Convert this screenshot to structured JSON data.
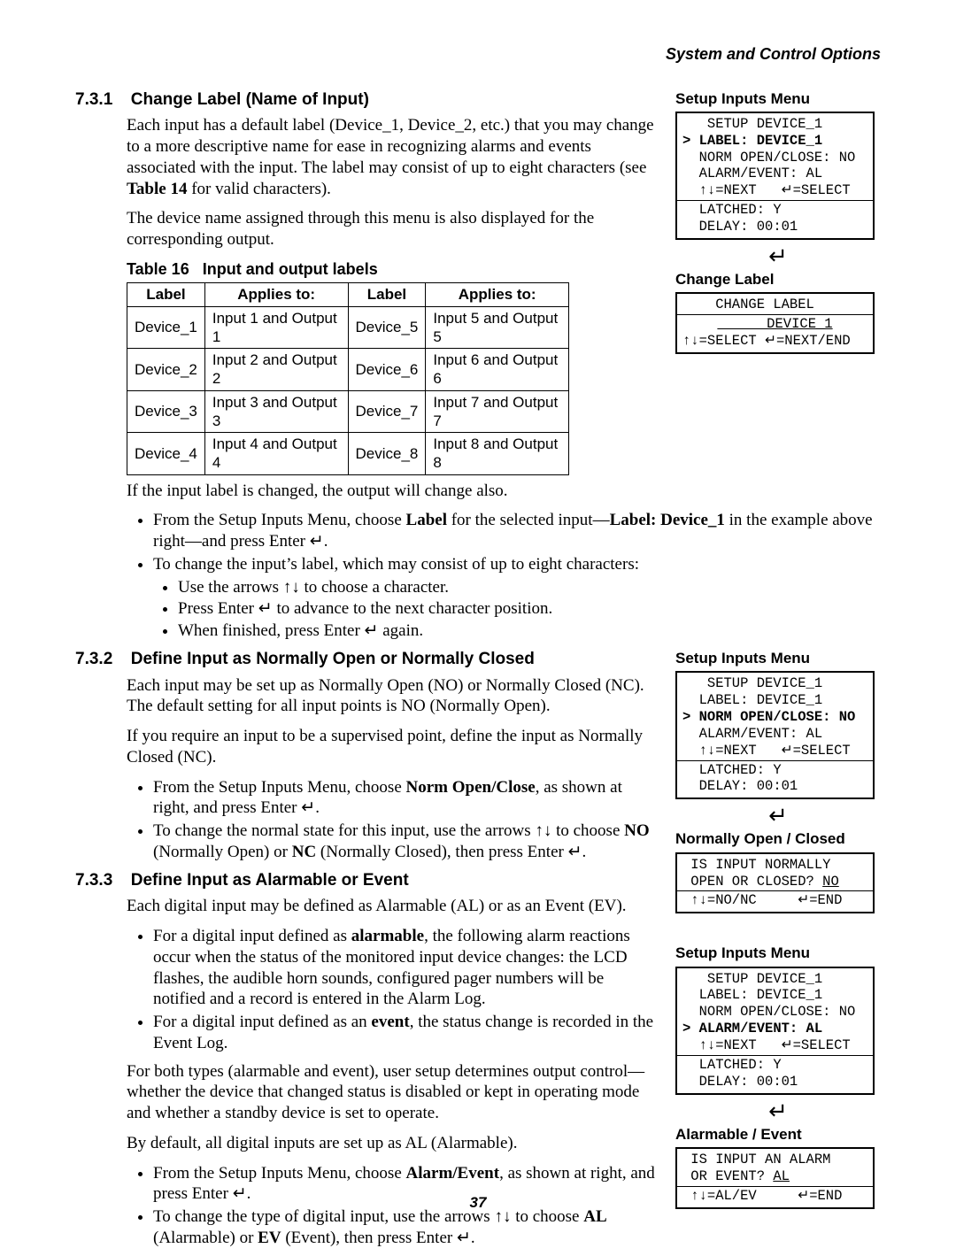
{
  "runhead": "System and Control Options",
  "page_number": "37",
  "glyphs": {
    "updown": "↑↓",
    "enter": "↵",
    "enter_big": "↵"
  },
  "sec_731": {
    "num": "7.3.1",
    "title": "Change Label (Name of Input)",
    "p1a": "Each input has a default label (Device_1, Device_2, etc.) that you may change to a more descriptive name for ease in recognizing alarms and events associated with the input. The label may consist of up to eight characters (see ",
    "p1b": "Table 14",
    "p1c": " for valid characters).",
    "p2": "The device name assigned through this menu is also displayed for the corresponding output.",
    "table_caption_a": "Table 16",
    "table_caption_b": "Input and output labels",
    "table_headers": [
      "Label",
      "Applies to:",
      "Label",
      "Applies to:"
    ],
    "table_rows": [
      [
        "Device_1",
        "Input 1 and Output 1",
        "Device_5",
        "Input 5 and Output 5"
      ],
      [
        "Device_2",
        "Input 2 and Output 2",
        "Device_6",
        "Input 6 and Output 6"
      ],
      [
        "Device_3",
        "Input 3 and Output 3",
        "Device_7",
        "Input 7 and Output 7"
      ],
      [
        "Device_4",
        "Input 4 and Output 4",
        "Device_8",
        "Input 8 and Output 8"
      ]
    ],
    "p3": "If the input label is changed, the output will change also.",
    "b1a": "From the Setup Inputs Menu, choose ",
    "b1b": "Label",
    "b1c": " for the selected input—",
    "b1d": "Label: Device_1",
    "b1e": " in the example above right—and press Enter ",
    "b1f": ".",
    "b2": "To change the input’s label, which may consist of up to eight characters:",
    "b2i1a": "Use the arrows ",
    "b2i1b": " to choose a character.",
    "b2i2a": "Press Enter ",
    "b2i2b": " to advance to the next character position.",
    "b2i3a": "When finished, press Enter ",
    "b2i3b": " again."
  },
  "lcd_731_setup": {
    "title": "Setup Inputs Menu",
    "l1": "   SETUP DEVICE_1",
    "l2": "> LABEL: DEVICE_1",
    "l3": "  NORM OPEN/CLOSE: NO",
    "l4": "  ALARM/EVENT: AL",
    "l5": "  ↑↓=NEXT   ↵=SELECT",
    "l6": "  LATCHED: Y",
    "l7": "  DELAY: 00:01"
  },
  "lcd_731_change": {
    "title": "Change Label",
    "l1": "    CHANGE LABEL",
    "l2": "      DEVICE_1",
    "l3": "↑↓=SELECT ↵=NEXT/END"
  },
  "sec_732": {
    "num": "7.3.2",
    "title": "Define Input as Normally Open or Normally Closed",
    "p1": "Each input may be set up as Normally Open (NO) or Normally Closed (NC). The default setting for all input points is NO (Normally Open).",
    "p2": "If you require an input to be a supervised point, define the input as Normally Closed (NC).",
    "b1a": "From the Setup Inputs Menu, choose ",
    "b1b": "Norm Open/Close",
    "b1c": ", as shown at right, and press Enter ",
    "b1d": ".",
    "b2a": "To change the normal state for this input, use the arrows ",
    "b2b": " to choose ",
    "b2c": "NO",
    "b2d": " (Normally Open) or ",
    "b2e": "NC",
    "b2f": " (Normally Closed), then press Enter ",
    "b2g": "."
  },
  "lcd_732_setup": {
    "title": "Setup Inputs Menu",
    "l1": "   SETUP DEVICE_1",
    "l2": "  LABEL: DEVICE_1",
    "l3": "> NORM OPEN/CLOSE: NO",
    "l4": "  ALARM/EVENT: AL",
    "l5": "  ↑↓=NEXT   ↵=SELECT",
    "l6": "  LATCHED: Y",
    "l7": "  DELAY: 00:01"
  },
  "lcd_732_noc": {
    "title": "Normally Open / Closed",
    "l1": " IS INPUT NORMALLY",
    "l2a": " OPEN OR CLOSED? ",
    "l2b": "NO",
    "l3": " ↑↓=NO/NC     ↵=END"
  },
  "sec_733": {
    "num": "7.3.3",
    "title": "Define Input as Alarmable or Event",
    "p1": "Each digital input may be defined as Alarmable (AL) or as an Event (EV).",
    "b1a": "For a digital input defined as ",
    "b1b": "alarmable",
    "b1c": ", the following alarm reactions occur when the status of the monitored input device changes: the LCD flashes, the audible horn sounds, configured pager numbers will be notified and a record is entered in the Alarm Log.",
    "b2a": "For a digital input defined as an ",
    "b2b": "event",
    "b2c": ", the status change is recorded in the Event Log.",
    "p2": "For both types (alarmable and event), user setup determines output control—whether the device that changed status is disabled or kept in operating mode and whether a standby device is set to operate.",
    "p3": "By default, all digital inputs are set up as AL (Alarmable).",
    "b3a": "From the Setup Inputs Menu, choose ",
    "b3b": "Alarm/Event",
    "b3c": ", as shown at right, and press Enter ",
    "b3d": ".",
    "b4a": "To change the type of digital input, use the arrows ",
    "b4b": " to choose ",
    "b4c": "AL",
    "b4d": " (Alarmable) or ",
    "b4e": "EV",
    "b4f": " (Event), then press Enter ",
    "b4g": "."
  },
  "lcd_733_setup": {
    "title": "Setup Inputs Menu",
    "l1": "   SETUP DEVICE_1",
    "l2": "  LABEL: DEVICE_1",
    "l3": "  NORM OPEN/CLOSE: NO",
    "l4": "> ALARM/EVENT: AL",
    "l5": "  ↑↓=NEXT   ↵=SELECT",
    "l6": "  LATCHED: Y",
    "l7": "  DELAY: 00:01"
  },
  "lcd_733_ae": {
    "title": "Alarmable / Event",
    "l1": " IS INPUT AN ALARM",
    "l2a": " OR EVENT? ",
    "l2b": "AL",
    "l3": " ↑↓=AL/EV     ↵=END"
  }
}
